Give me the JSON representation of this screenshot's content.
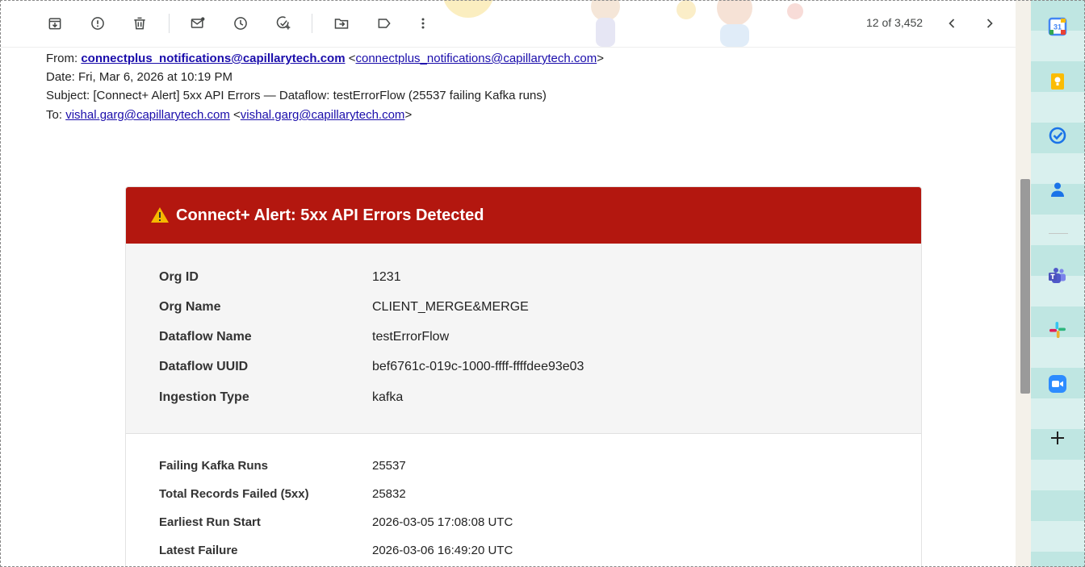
{
  "toolbar": {
    "pager_text": "12 of 3,452"
  },
  "email": {
    "from_label": "From:",
    "from_name": "connectplus_notifications@capillarytech.com",
    "from_lt": "<",
    "from_address": "connectplus_notifications@capillarytech.com",
    "from_gt": ">",
    "date_line": "Date: Fri, Mar 6, 2026 at 10:19 PM",
    "subject_line": "Subject: [Connect+ Alert] 5xx API Errors — Dataflow: testErrorFlow (25537 failing Kafka runs)",
    "to_label": "To:",
    "to_name": "vishal.garg@capillarytech.com",
    "to_lt": "<",
    "to_address": "vishal.garg@capillarytech.com",
    "to_gt": ">"
  },
  "alert": {
    "title": "Connect+ Alert: 5xx API Errors Detected",
    "details": [
      {
        "label": "Org ID",
        "value": "1231"
      },
      {
        "label": "Org Name",
        "value": "CLIENT_MERGE&MERGE"
      },
      {
        "label": "Dataflow Name",
        "value": "testErrorFlow"
      },
      {
        "label": "Dataflow UUID",
        "value": "bef6761c-019c-1000-ffff-ffffdee93e03"
      },
      {
        "label": "Ingestion Type",
        "value": "kafka"
      }
    ],
    "stats": [
      {
        "label": "Failing Kafka Runs",
        "value": "25537"
      },
      {
        "label": "Total Records Failed (5xx)",
        "value": "25832"
      },
      {
        "label": "Earliest Run Start",
        "value": "2026-03-05 17:08:08 UTC"
      },
      {
        "label": "Latest Failure",
        "value": "2026-03-06 16:49:20 UTC"
      }
    ]
  },
  "side_panel": {
    "calendar_day": "31"
  },
  "colors": {
    "alert_header": "#b3170f",
    "link": "#1a0dab",
    "side_panel": "#bfe6e2"
  }
}
